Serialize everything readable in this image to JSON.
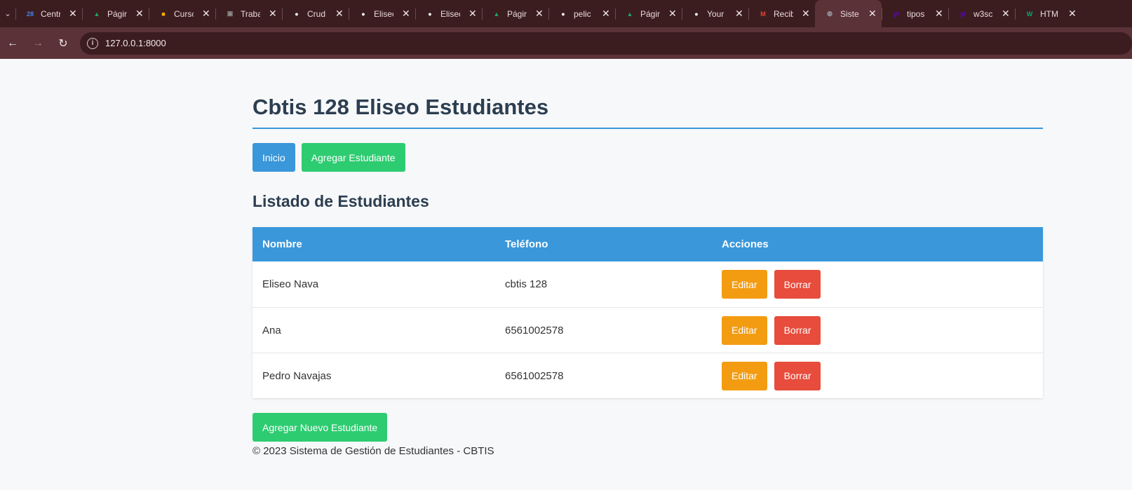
{
  "browser": {
    "tabs": [
      {
        "label": "Centr",
        "icon": "calendar-icon",
        "color": "#4285f4",
        "glyph": "28"
      },
      {
        "label": "Págir",
        "icon": "google-drive-icon",
        "color": "#1fa463",
        "glyph": "▲"
      },
      {
        "label": "Cursc",
        "icon": "slides-icon",
        "color": "#f4b400",
        "glyph": "■"
      },
      {
        "label": "Traba",
        "icon": "classroom-icon",
        "color": "#8d8d8d",
        "glyph": "▣"
      },
      {
        "label": "Crud",
        "icon": "github-icon",
        "color": "#ffffff",
        "glyph": "●"
      },
      {
        "label": "Elisec",
        "icon": "github-icon",
        "color": "#ffffff",
        "glyph": "●"
      },
      {
        "label": "Elisec",
        "icon": "github-icon",
        "color": "#ffffff",
        "glyph": "●"
      },
      {
        "label": "Págir",
        "icon": "google-drive-icon",
        "color": "#1fa463",
        "glyph": "▲"
      },
      {
        "label": "pelic",
        "icon": "github-icon",
        "color": "#ffffff",
        "glyph": "●"
      },
      {
        "label": "Págir",
        "icon": "google-drive-icon",
        "color": "#1fa463",
        "glyph": "▲"
      },
      {
        "label": "Your",
        "icon": "github-icon",
        "color": "#ffffff",
        "glyph": "●"
      },
      {
        "label": "Recib",
        "icon": "gmail-icon",
        "color": "#ea4335",
        "glyph": "M"
      },
      {
        "label": "Siste",
        "icon": "globe-icon",
        "color": "#9aa0a6",
        "glyph": "◍",
        "active": true
      },
      {
        "label": "tipos",
        "icon": "yahoo-icon",
        "color": "#6001d2",
        "glyph": "y!"
      },
      {
        "label": "w3sc",
        "icon": "yahoo-icon",
        "color": "#6001d2",
        "glyph": "y!"
      },
      {
        "label": "HTM",
        "icon": "w3-icon",
        "color": "#04aa6d",
        "glyph": "W"
      }
    ],
    "url": "127.0.0.1:8000"
  },
  "page": {
    "title": "Cbtis 128 Eliseo Estudiantes",
    "nav": {
      "home": "Inicio",
      "add": "Agregar Estudiante"
    },
    "section_title": "Listado de Estudiantes",
    "table": {
      "headers": [
        "Nombre",
        "Teléfono",
        "Acciones"
      ],
      "rows": [
        {
          "name": "Eliseo Nava",
          "phone": "cbtis 128"
        },
        {
          "name": "Ana",
          "phone": "6561002578"
        },
        {
          "name": "Pedro Navajas",
          "phone": "6561002578"
        }
      ],
      "edit_label": "Editar",
      "delete_label": "Borrar"
    },
    "add_new_label": "Agregar Nuevo Estudiante",
    "footer": "© 2023 Sistema de Gestión de Estudiantes - CBTIS"
  },
  "colors": {
    "primary": "#3a97da",
    "success": "#2ecc71",
    "warning": "#f39c12",
    "danger": "#e74c3c",
    "heading": "#2c3e50"
  }
}
